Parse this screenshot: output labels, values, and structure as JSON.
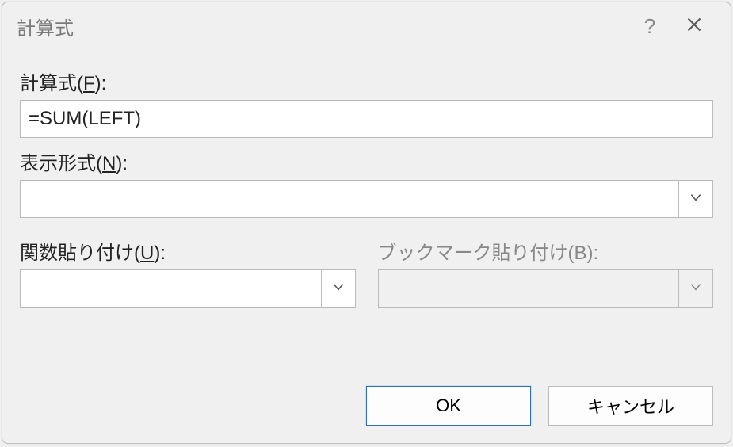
{
  "titlebar": {
    "title": "計算式"
  },
  "formula": {
    "label_prefix": "計算式(",
    "label_mnemonic": "F",
    "label_suffix": "):",
    "value": "=SUM(LEFT)"
  },
  "number_format": {
    "label_prefix": "表示形式(",
    "label_mnemonic": "N",
    "label_suffix": "):",
    "value": ""
  },
  "paste_function": {
    "label_prefix": "関数貼り付け(",
    "label_mnemonic": "U",
    "label_suffix": "):",
    "value": ""
  },
  "paste_bookmark": {
    "label": "ブックマーク貼り付け(B):",
    "value": ""
  },
  "buttons": {
    "ok": "OK",
    "cancel": "キャンセル"
  }
}
